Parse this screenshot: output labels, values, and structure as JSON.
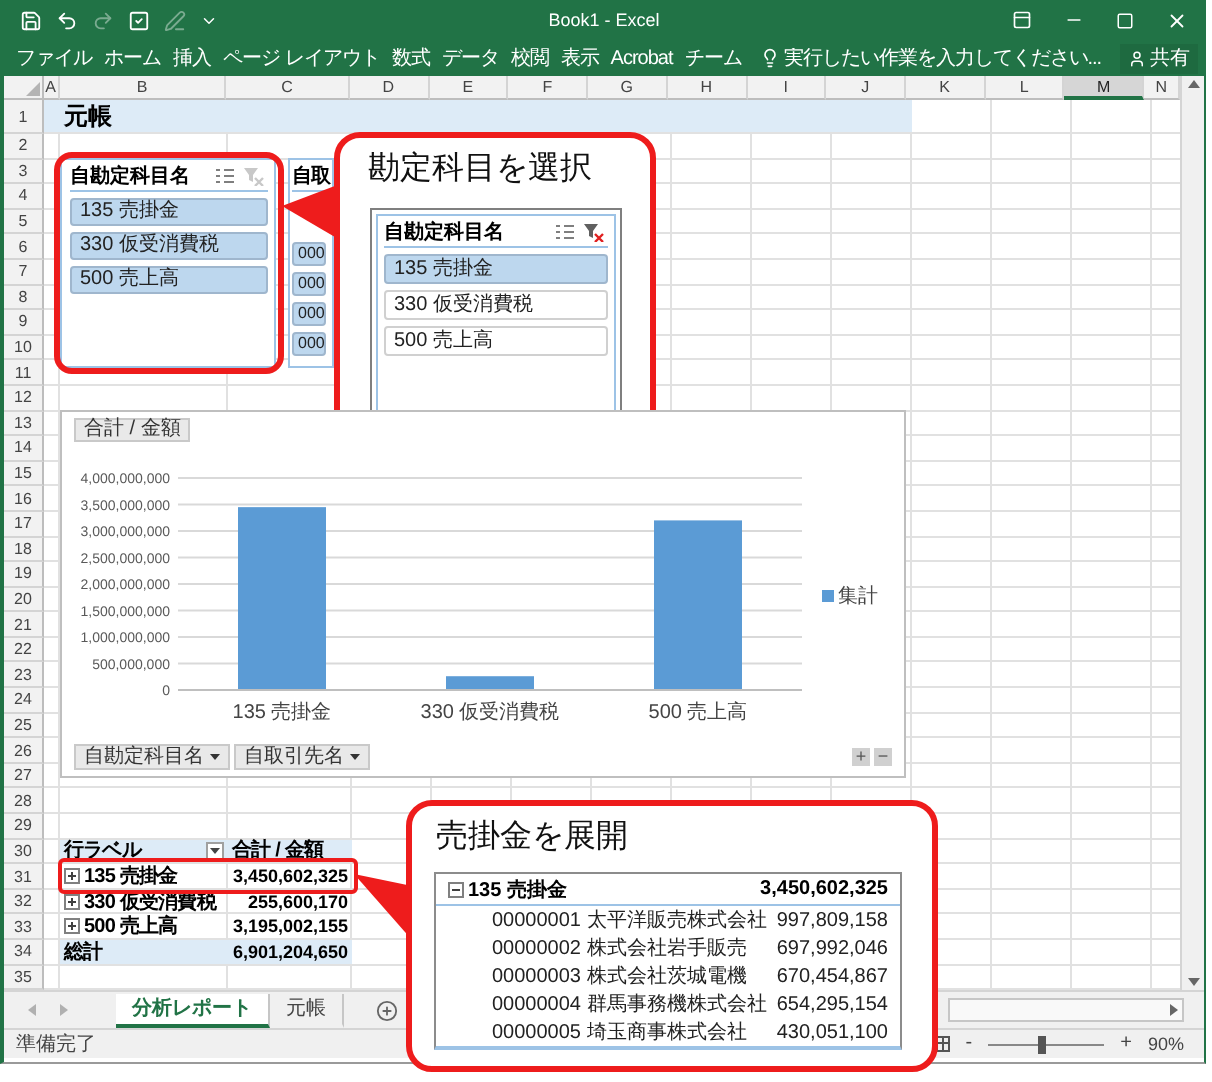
{
  "window": {
    "title": "Book1 - Excel"
  },
  "quick_access": [
    {
      "kind": "save",
      "disabled": false
    },
    {
      "kind": "undo",
      "disabled": false
    },
    {
      "kind": "redo",
      "disabled": true
    },
    {
      "kind": "check",
      "disabled": false
    },
    {
      "kind": "pen",
      "disabled": true
    },
    {
      "kind": "customize",
      "disabled": false
    }
  ],
  "ribbon": {
    "tabs": [
      {
        "label": "ファイル",
        "selected": false
      },
      {
        "label": "ホーム",
        "selected": false
      },
      {
        "label": "挿入",
        "selected": false
      },
      {
        "label": "ページ レイアウト",
        "selected": false
      },
      {
        "label": "数式",
        "selected": false
      },
      {
        "label": "データ",
        "selected": false
      },
      {
        "label": "校閲",
        "selected": false
      },
      {
        "label": "表示",
        "selected": false
      },
      {
        "label": "Acrobat",
        "selected": false
      },
      {
        "label": "チーム",
        "selected": false
      }
    ],
    "tell_me": {
      "placeholder": "実行したい作業を入力してください..."
    },
    "share": "共有"
  },
  "columns": [
    {
      "label": "A",
      "selected": false
    },
    {
      "label": "B",
      "selected": false
    },
    {
      "label": "C",
      "selected": false
    },
    {
      "label": "D",
      "selected": false
    },
    {
      "label": "E",
      "selected": false
    },
    {
      "label": "F",
      "selected": false
    },
    {
      "label": "G",
      "selected": false
    },
    {
      "label": "H",
      "selected": false
    },
    {
      "label": "I",
      "selected": false
    },
    {
      "label": "J",
      "selected": false
    },
    {
      "label": "K",
      "selected": false
    },
    {
      "label": "L",
      "selected": false
    },
    {
      "label": "M",
      "selected": true
    },
    {
      "label": "N",
      "selected": false
    }
  ],
  "rows": [
    "1",
    "2",
    "3",
    "4",
    "5",
    "6",
    "7",
    "8",
    "9",
    "10",
    "11",
    "12",
    "13",
    "14",
    "15",
    "16",
    "17",
    "18",
    "19",
    "20",
    "21",
    "22",
    "23",
    "24",
    "25",
    "26",
    "27",
    "28",
    "29",
    "30",
    "31",
    "32",
    "33",
    "34",
    "35"
  ],
  "sheet_title": "元帳",
  "slicers": [
    {
      "header": "自勘定科目名",
      "filtered": false,
      "items": [
        {
          "label": "135 売掛金",
          "selected": true
        },
        {
          "label": "330 仮受消費税",
          "selected": true
        },
        {
          "label": "500 売上高",
          "selected": true
        }
      ]
    },
    {
      "header": "自取",
      "items": [
        {
          "label": "000",
          "selected": true
        },
        {
          "label": "000",
          "selected": true
        },
        {
          "label": "000",
          "selected": true
        },
        {
          "label": "000",
          "selected": true
        }
      ]
    }
  ],
  "chart": {
    "value_button": "合計 / 金額",
    "filter_buttons": [
      "自勘定科目名",
      "自取引先名"
    ],
    "size_buttons": [
      "+",
      "−"
    ],
    "chart_data": {
      "type": "bar",
      "grid": true,
      "categories": [
        "135 売掛金",
        "330 仮受消費税",
        "500 売上高"
      ],
      "series": [
        {
          "name": "集計",
          "color": "#5b9bd5",
          "values": [
            3450000000,
            260000000,
            3200000000
          ]
        }
      ],
      "ylim": [
        0,
        4000000000
      ],
      "yticks": [
        {
          "value": 0,
          "label": "0"
        },
        {
          "value": 500000000,
          "label": "500,000,000"
        },
        {
          "value": 1000000000,
          "label": "1,000,000,000"
        },
        {
          "value": 1500000000,
          "label": "1,500,000,000"
        },
        {
          "value": 2000000000,
          "label": "2,000,000,000"
        },
        {
          "value": 2500000000,
          "label": "2,500,000,000"
        },
        {
          "value": 3000000000,
          "label": "3,000,000,000"
        },
        {
          "value": 3500000000,
          "label": "3,500,000,000"
        },
        {
          "value": 4000000000,
          "label": "4,000,000,000"
        }
      ]
    }
  },
  "pivot": {
    "header": {
      "label": "行ラベル",
      "value": "合計 / 金額"
    },
    "rows": [
      {
        "label": "135 売掛金",
        "value": "3,450,602,325",
        "expanded": false
      },
      {
        "label": "330 仮受消費税",
        "value": "255,600,170",
        "expanded": false
      },
      {
        "label": "500 売上高",
        "value": "3,195,002,155",
        "expanded": false
      }
    ],
    "total": {
      "label": "総計",
      "value": "6,901,204,650"
    }
  },
  "callout_select": {
    "title": "勘定科目を選択",
    "slicer": {
      "header": "自勘定科目名",
      "filtered": true,
      "items": [
        {
          "label": "135 売掛金",
          "selected": true
        },
        {
          "label": "330 仮受消費税",
          "selected": false
        },
        {
          "label": "500 売上高",
          "selected": false
        }
      ]
    }
  },
  "callout_expand": {
    "title": "売掛金を展開",
    "group": {
      "label": "135 売掛金",
      "value": "3,450,602,325",
      "expanded": true
    },
    "rows": [
      {
        "label": "00000001 太平洋販売株式会社",
        "value": "997,809,158"
      },
      {
        "label": "00000002 株式会社岩手販売",
        "value": "697,992,046"
      },
      {
        "label": "00000003 株式会社茨城電機",
        "value": "670,454,867"
      },
      {
        "label": "00000004 群馬事務機株式会社",
        "value": "654,295,154"
      },
      {
        "label": "00000005 埼玉商事株式会社",
        "value": "430,051,100"
      }
    ]
  },
  "sheet_tabs": [
    {
      "label": "分析レポート",
      "selected": true
    },
    {
      "label": "元帳",
      "selected": false
    }
  ],
  "status": {
    "text": "準備完了",
    "zoom_out": "-",
    "zoom_in": "+",
    "zoom": "90%",
    "zoom_slider": {
      "level": 0.46
    }
  }
}
